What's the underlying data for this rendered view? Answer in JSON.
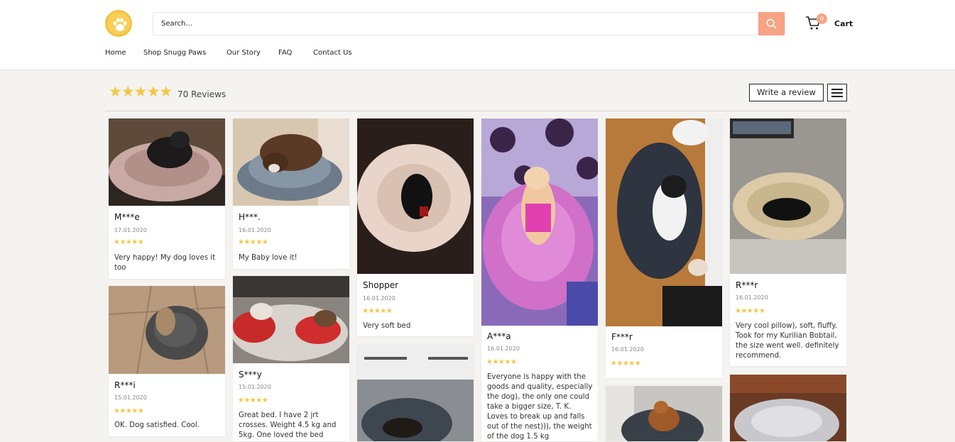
{
  "header": {
    "logo_icon": "paw-icon",
    "search": {
      "placeholder": "Search..."
    },
    "cart": {
      "count": "0",
      "label": "Cart"
    },
    "nav": [
      "Home",
      "Shop Snugg Paws",
      "Our Story",
      "FAQ",
      "Contact Us"
    ]
  },
  "summary": {
    "stars": "★★★★★",
    "reviews_label": "70 Reviews",
    "write_review_label": "Write a review"
  },
  "colors": {
    "accent": "#f7a384",
    "star": "#f2c744",
    "logo": "#f6cf58",
    "background": "#f5f3f0"
  },
  "reviews": [
    {
      "name": "M***e",
      "date": "17.01.2020",
      "stars": "★★★★★",
      "text": "Very happy! My dog loves it too"
    },
    {
      "name": "H***.",
      "date": "16.01.2020",
      "stars": "★★★★★",
      "text": "My Baby love it!"
    },
    {
      "name": "Shopper",
      "date": "16.01.2020",
      "stars": "★★★★★",
      "text": "Very soft bed"
    },
    {
      "name": "A***a",
      "date": "16.01.2020",
      "stars": "★★★★★",
      "text": "Everyone is happy with the goods and quality, especially the dog), the only one could take a bigger size, T. K. Loves to break up and falls out of the nest))), the weight of the dog 1.5 kg"
    },
    {
      "name": "F***r",
      "date": "16.01.2020",
      "stars": "★★★★★",
      "text": ""
    },
    {
      "name": "R***r",
      "date": "16.01.2020",
      "stars": "★★★★★",
      "text": "Very cool pillow), soft, fluffy. Took for my Kurilian Bobtail, the size went well. definitely recommend."
    },
    {
      "name": "R***i",
      "date": "15.01.2020",
      "stars": "★★★★★",
      "text": "OK. Dog satisfied. Cool."
    },
    {
      "name": "S***y",
      "date": "15.01.2020",
      "stars": "★★★★★",
      "text": "Great bed. I have 2 jrt crosses. Weight 4.5 kg and 5kg. One loved the bed"
    }
  ]
}
